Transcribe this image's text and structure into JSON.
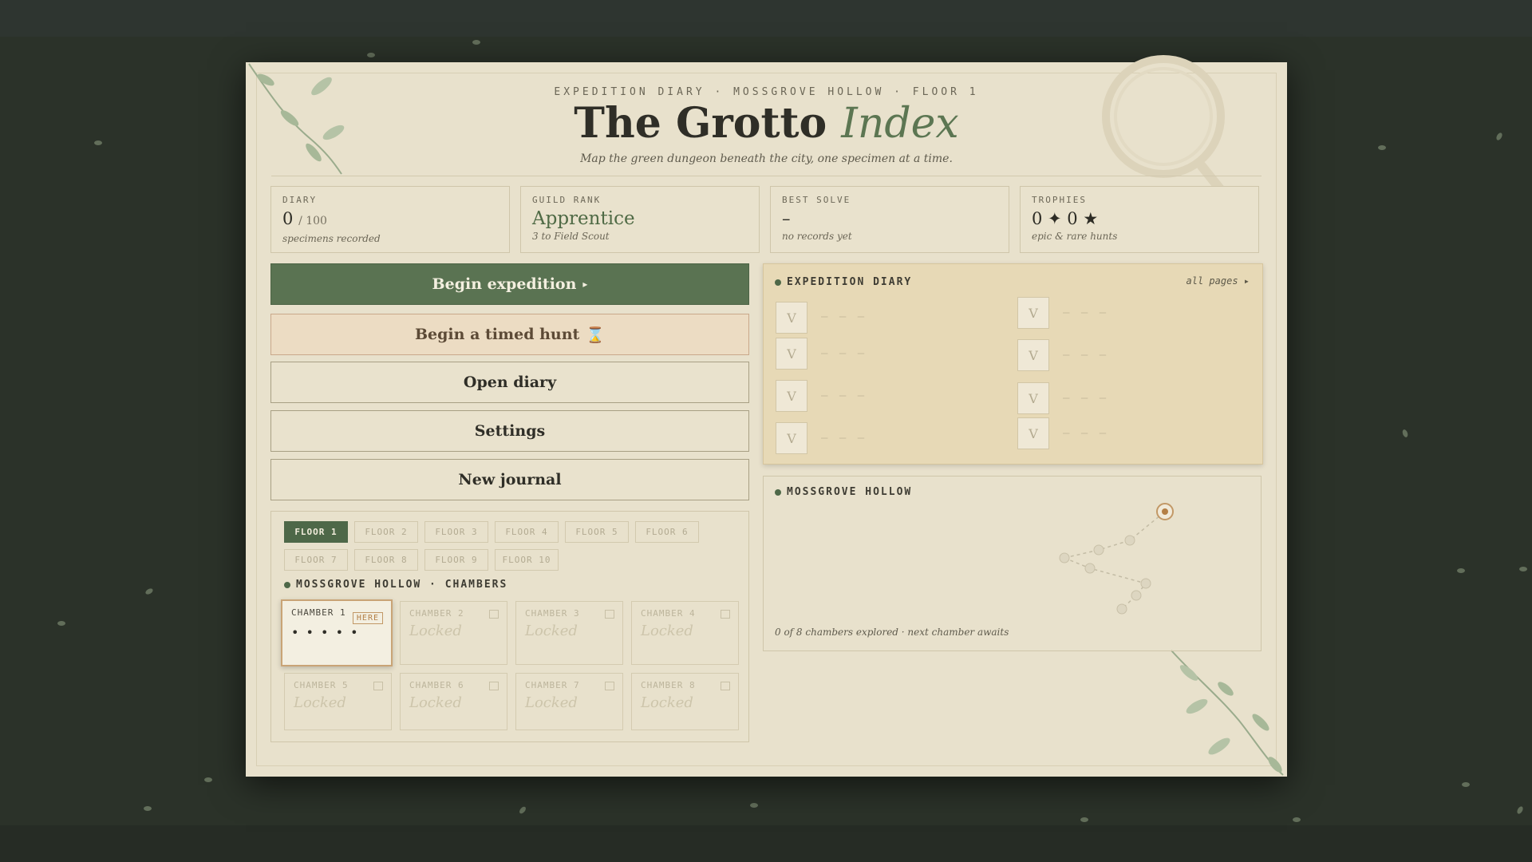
{
  "header": {
    "kicker": "EXPEDITION DIARY · MOSSGROVE HOLLOW · FLOOR 1",
    "title_main": "The Grotto",
    "title_accent": "Index",
    "subtitle": "Map the green dungeon beneath the city, one specimen at a time."
  },
  "stats": [
    {
      "label": "DIARY",
      "value": "0",
      "suffix": "/ 100",
      "note": "specimens recorded"
    },
    {
      "label": "GUILD RANK",
      "value": "Apprentice",
      "note": "3 to Field Scout"
    },
    {
      "label": "BEST SOLVE",
      "value": "–",
      "note": "no records yet"
    },
    {
      "label": "TROPHIES",
      "value": "0 ✦ 0 ★",
      "note": "epic & rare hunts"
    }
  ],
  "actions": {
    "begin": "Begin expedition",
    "begin_arrow": "▸",
    "timed": "Begin a timed hunt",
    "timed_icon": "⌛",
    "diary": "Open diary",
    "settings": "Settings",
    "new_journal": "New journal"
  },
  "floors": [
    "FLOOR 1",
    "FLOOR 2",
    "FLOOR 3",
    "FLOOR 4",
    "FLOOR 5",
    "FLOOR 6",
    "FLOOR 7",
    "FLOOR 8",
    "FLOOR 9",
    "FLOOR 10"
  ],
  "chambers_section": "MOSSGROVE HOLLOW · CHAMBERS",
  "chambers": [
    {
      "name": "CHAMBER 1",
      "badge": "HERE",
      "pips": "• • • • •"
    },
    {
      "name": "CHAMBER 2",
      "state": "Locked"
    },
    {
      "name": "CHAMBER 3",
      "state": "Locked"
    },
    {
      "name": "CHAMBER 4",
      "state": "Locked"
    },
    {
      "name": "CHAMBER 5",
      "state": "Locked"
    },
    {
      "name": "CHAMBER 6",
      "state": "Locked"
    },
    {
      "name": "CHAMBER 7",
      "state": "Locked"
    },
    {
      "name": "CHAMBER 8",
      "state": "Locked"
    }
  ],
  "diary_card": {
    "title": "EXPEDITION DIARY",
    "link": "all pages ▸",
    "slot_glyph": "V",
    "dash": "— — —"
  },
  "map_card": {
    "title": "MOSSGROVE HOLLOW",
    "caption": "0 of 8 chambers explored · next chamber awaits"
  },
  "colors": {
    "panel": "#e8e1cc",
    "accent_green": "#5a7352",
    "timed_bg": "#ecdcc3",
    "here_badge": "#c29866"
  }
}
